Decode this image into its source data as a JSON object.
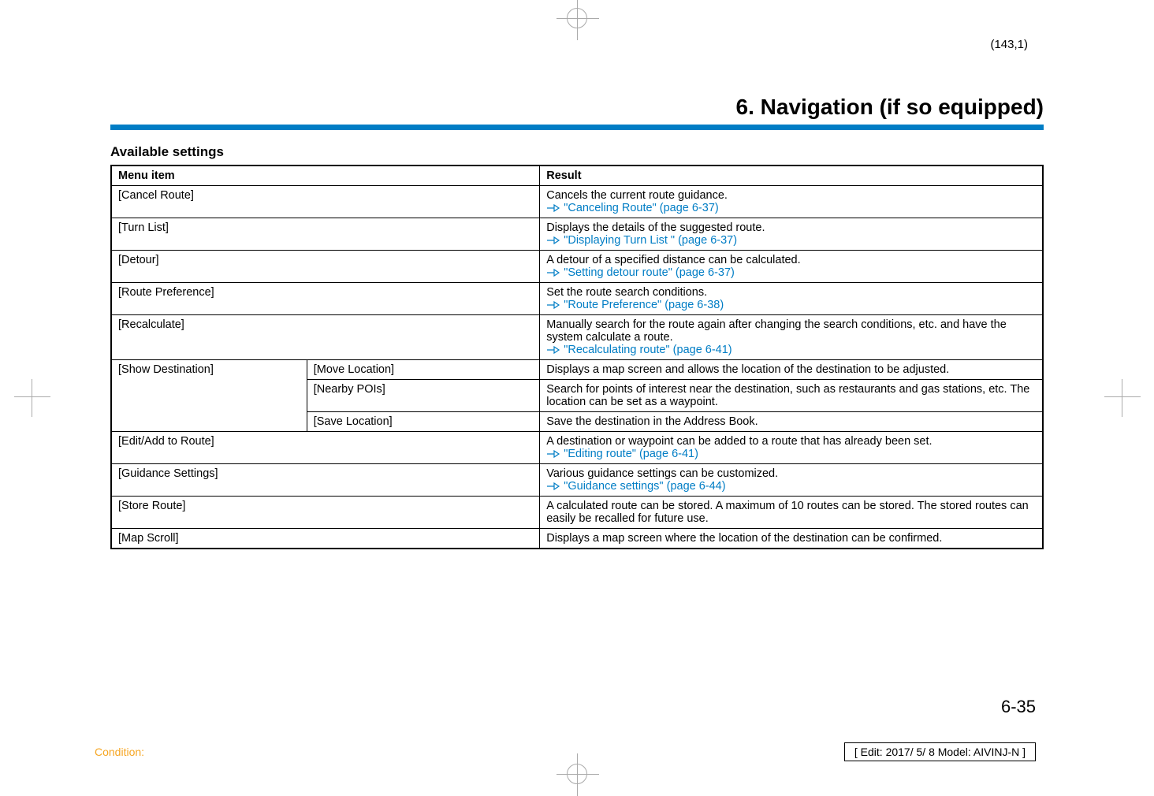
{
  "coord": "(143,1)",
  "chapter_title": "6. Navigation (if so equipped)",
  "section_heading": "Available settings",
  "headers": {
    "menu": "Menu item",
    "result": "Result"
  },
  "rows": {
    "cancel_route": {
      "menu": "[Cancel Route]",
      "desc": "Cancels the current route guidance.",
      "ref": "\"Canceling Route\" (page 6-37)"
    },
    "turn_list": {
      "menu": "[Turn List]",
      "desc": "Displays the details of the suggested route.",
      "ref": "\"Displaying Turn List \" (page 6-37)"
    },
    "detour": {
      "menu": "[Detour]",
      "desc": "A detour of a specified distance can be calculated.",
      "ref": "\"Setting detour route\" (page 6-37)"
    },
    "route_pref": {
      "menu": "[Route Preference]",
      "desc": "Set the route search conditions.",
      "ref": "\"Route Preference\" (page 6-38)"
    },
    "recalc": {
      "menu": "[Recalculate]",
      "desc": "Manually search for the route again after changing the search conditions, etc. and have the system calculate a route.",
      "ref": "\"Recalculating route\" (page 6-41)"
    },
    "show_dest": {
      "menu": "[Show Destination]",
      "sub": {
        "move": {
          "label": "[Move Location]",
          "desc": "Displays a map screen and allows the location of the destination to be adjusted."
        },
        "nearby": {
          "label": "[Nearby POIs]",
          "desc": "Search for points of interest near the destination, such as restaurants and gas stations, etc. The location can be set as a waypoint."
        },
        "save": {
          "label": "[Save Location]",
          "desc": "Save the destination in the Address Book."
        }
      }
    },
    "edit_add": {
      "menu": "[Edit/Add to Route]",
      "desc": "A destination or waypoint can be added to a route that has already been set.",
      "ref": "\"Editing route\" (page 6-41)"
    },
    "guidance": {
      "menu": "[Guidance Settings]",
      "desc": "Various guidance settings can be customized.",
      "ref": "\"Guidance settings\" (page 6-44)"
    },
    "store": {
      "menu": "[Store Route]",
      "desc": "A calculated route can be stored. A maximum of 10 routes can be stored. The stored routes can easily be recalled for future use."
    },
    "map_scroll": {
      "menu": "[Map Scroll]",
      "desc": "Displays a map screen where the location of the destination can be confirmed."
    }
  },
  "page_number": "6-35",
  "condition_label": "Condition:",
  "edit_info": "[ Edit: 2017/ 5/ 8   Model: AIVINJ-N ]"
}
